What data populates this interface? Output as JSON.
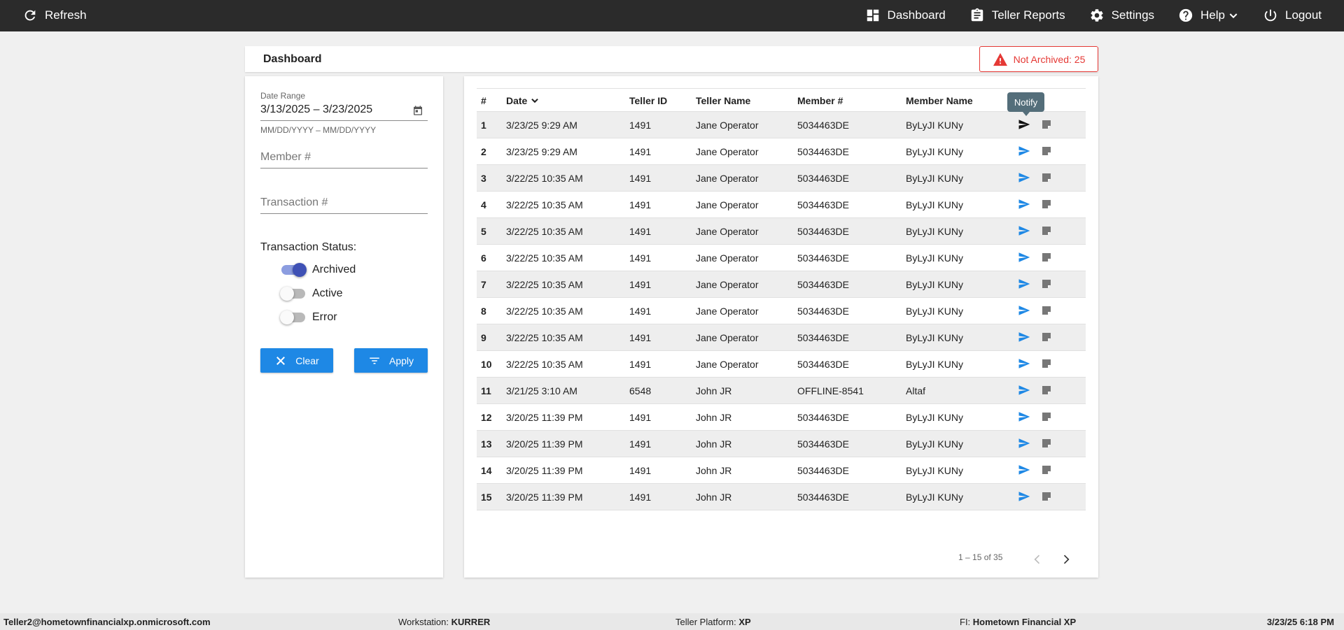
{
  "topbar": {
    "refresh_label": "Refresh",
    "nav": [
      {
        "label": "Dashboard",
        "icon": "dashboard-icon"
      },
      {
        "label": "Teller Reports",
        "icon": "clipboard-icon"
      },
      {
        "label": "Settings",
        "icon": "gear-icon"
      },
      {
        "label": "Help",
        "icon": "help-icon"
      },
      {
        "label": "Logout",
        "icon": "power-icon"
      }
    ]
  },
  "header": {
    "title": "Dashboard",
    "alert_text": "Not Archived: 25",
    "alert_color": "#e53935"
  },
  "filters": {
    "date_range_label": "Date Range",
    "date_range_value": "3/13/2025 – 3/23/2025",
    "date_hint": "MM/DD/YYYY – MM/DD/YYYY",
    "member_placeholder": "Member #",
    "transaction_placeholder": "Transaction #",
    "status_label": "Transaction Status:",
    "statuses": [
      {
        "label": "Archived",
        "on": true
      },
      {
        "label": "Active",
        "on": false
      },
      {
        "label": "Error",
        "on": false
      }
    ],
    "clear_label": "Clear",
    "apply_label": "Apply"
  },
  "table": {
    "columns": [
      "#",
      "Date",
      "Teller ID",
      "Teller Name",
      "Member #",
      "Member Name"
    ],
    "tooltip": "Notify",
    "rows": [
      [
        "1",
        "3/23/25 9:29 AM",
        "1491",
        "Jane Operator",
        "5034463DE",
        "ByLyJI KUNy"
      ],
      [
        "2",
        "3/23/25 9:29 AM",
        "1491",
        "Jane Operator",
        "5034463DE",
        "ByLyJI KUNy"
      ],
      [
        "3",
        "3/22/25 10:35 AM",
        "1491",
        "Jane Operator",
        "5034463DE",
        "ByLyJI KUNy"
      ],
      [
        "4",
        "3/22/25 10:35 AM",
        "1491",
        "Jane Operator",
        "5034463DE",
        "ByLyJI KUNy"
      ],
      [
        "5",
        "3/22/25 10:35 AM",
        "1491",
        "Jane Operator",
        "5034463DE",
        "ByLyJI KUNy"
      ],
      [
        "6",
        "3/22/25 10:35 AM",
        "1491",
        "Jane Operator",
        "5034463DE",
        "ByLyJI KUNy"
      ],
      [
        "7",
        "3/22/25 10:35 AM",
        "1491",
        "Jane Operator",
        "5034463DE",
        "ByLyJI KUNy"
      ],
      [
        "8",
        "3/22/25 10:35 AM",
        "1491",
        "Jane Operator",
        "5034463DE",
        "ByLyJI KUNy"
      ],
      [
        "9",
        "3/22/25 10:35 AM",
        "1491",
        "Jane Operator",
        "5034463DE",
        "ByLyJI KUNy"
      ],
      [
        "10",
        "3/22/25 10:35 AM",
        "1491",
        "Jane Operator",
        "5034463DE",
        "ByLyJI KUNy"
      ],
      [
        "11",
        "3/21/25 3:10 AM",
        "6548",
        "John JR",
        "OFFLINE-8541",
        "Altaf"
      ],
      [
        "12",
        "3/20/25 11:39 PM",
        "1491",
        "John JR",
        "5034463DE",
        "ByLyJI KUNy"
      ],
      [
        "13",
        "3/20/25 11:39 PM",
        "1491",
        "John JR",
        "5034463DE",
        "ByLyJI KUNy"
      ],
      [
        "14",
        "3/20/25 11:39 PM",
        "1491",
        "John JR",
        "5034463DE",
        "ByLyJI KUNy"
      ],
      [
        "15",
        "3/20/25 11:39 PM",
        "1491",
        "John JR",
        "5034463DE",
        "ByLyJI KUNy"
      ]
    ],
    "pagination": "1 – 15 of 35"
  },
  "footer": {
    "user": "Teller2@hometownfinancialxp.onmicrosoft.com",
    "workstation_label": "Workstation:",
    "workstation_value": "KURRER",
    "platform_label": "Teller Platform:",
    "platform_value": "XP",
    "fi_label": "FI:",
    "fi_value": "Hometown Financial XP",
    "datetime": "3/23/25 6:18 PM"
  }
}
